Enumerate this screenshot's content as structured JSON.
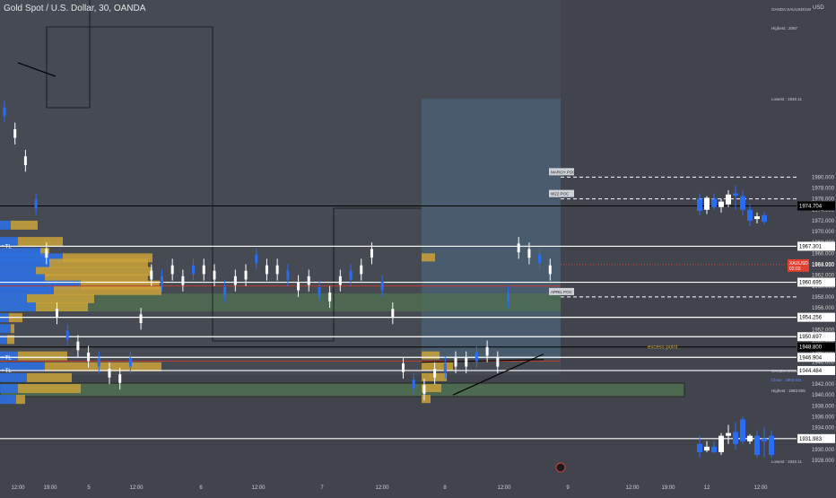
{
  "colors": {
    "background": "#41444c",
    "up": "#ffffff",
    "down": "#2a6df5",
    "profile_gold": "#caa23a",
    "profile_blue": "#2d6fe0",
    "zone_green": "#4f6e50",
    "zone_blue": "#4d6b85",
    "axis_text": "#d0d0d0",
    "price_tag": "#e0402f"
  },
  "chart_data": {
    "type": "candlestick",
    "title": "Gold Spot / U.S. Dollar, 30, OANDA",
    "ylim": [
      1926.5,
      2002.5
    ],
    "price_ticks": [
      1928.0,
      1930.0,
      1932.0,
      1934.0,
      1936.0,
      1938.0,
      1940.0,
      1942.0,
      1944.0,
      1946.0,
      1948.0,
      1950.0,
      1952.0,
      1954.0,
      1956.0,
      1958.0,
      1960.0,
      1962.0,
      1964.0,
      1966.0,
      1968.0,
      1970.0,
      1972.0,
      1974.0,
      1976.0,
      1978.0,
      1980.0
    ],
    "axis_unit": "USD",
    "time_labels": [
      "12:00",
      "19:00",
      "5",
      "12:00",
      "6",
      "12:00",
      "7",
      "12:00",
      "8",
      "12:00",
      "9",
      "12:00",
      "19:00",
      "12",
      "12:00"
    ],
    "horizontal_levels": [
      {
        "price": 1974.704,
        "label": "1974.704",
        "style": "solid-dark"
      },
      {
        "price": 1967.301,
        "label": "1967.301",
        "style": "solid"
      },
      {
        "price": 1960.695,
        "label": "1960.695",
        "style": "solid"
      },
      {
        "price": 1954.256,
        "label": "1954.256",
        "style": "solid"
      },
      {
        "price": 1950.697,
        "label": "1950.697",
        "style": "solid"
      },
      {
        "price": 1948.8,
        "label": "1948.800",
        "style": "solid-dark"
      },
      {
        "price": 1946.904,
        "label": "1946.904",
        "style": "solid"
      },
      {
        "price": 1944.484,
        "label": "1944.484",
        "style": "solid"
      },
      {
        "price": 1931.983,
        "label": "1931.983",
        "style": "solid"
      }
    ],
    "poc_levels": [
      {
        "label": "MARCH POC",
        "price": 1980.0
      },
      {
        "label": "W22 POC",
        "price": 1976.0
      },
      {
        "label": "APRIL POC",
        "price": 1958.0
      }
    ],
    "current_price": {
      "symbol": "XAUUSD",
      "value": "1963.930",
      "countdown": "02:03"
    },
    "annotations": {
      "excess_point": "excess point",
      "tl_label": "TL"
    },
    "inset_weekly": {
      "symbol": "OANDA:XAUUSD/1W",
      "highest": "Highest : 2067",
      "lowest": "Lowest : 1932.11"
    },
    "inset_daily": {
      "symbol": "OANDA:XAUUSD/1D",
      "close": "Close : 1963.931",
      "highest": "Highest : 1983.505",
      "lowest": "Lowest : 1932.11"
    },
    "weekly_candles": [
      {
        "o": 1976.0,
        "h": 1977.0,
        "l": 1973.0,
        "c": 1973.8
      },
      {
        "o": 1974.0,
        "h": 1976.5,
        "l": 1973.2,
        "c": 1976.2
      },
      {
        "o": 1976.0,
        "h": 1977.0,
        "l": 1974.0,
        "c": 1974.5
      },
      {
        "o": 1974.5,
        "h": 1976.0,
        "l": 1973.5,
        "c": 1975.5
      },
      {
        "o": 1975.0,
        "h": 1977.6,
        "l": 1974.5,
        "c": 1976.8
      },
      {
        "o": 1977.0,
        "h": 1978.5,
        "l": 1974.0,
        "c": 1976.6
      },
      {
        "o": 1976.5,
        "h": 1977.5,
        "l": 1973.0,
        "c": 1974.0
      },
      {
        "o": 1974.0,
        "h": 1975.0,
        "l": 1971.0,
        "c": 1972.0
      },
      {
        "o": 1972.3,
        "h": 1973.5,
        "l": 1971.5,
        "c": 1972.8
      },
      {
        "o": 1973.0,
        "h": 1973.6,
        "l": 1971.3,
        "c": 1971.8
      }
    ],
    "daily_candles": [
      {
        "o": 1931.0,
        "h": 1932.5,
        "l": 1928.5,
        "c": 1929.5
      },
      {
        "o": 1929.8,
        "h": 1931.5,
        "l": 1929.5,
        "c": 1930.5
      },
      {
        "o": 1930.5,
        "h": 1931.5,
        "l": 1929.3,
        "c": 1929.5
      },
      {
        "o": 1929.5,
        "h": 1933.0,
        "l": 1929.0,
        "c": 1932.5
      },
      {
        "o": 1932.5,
        "h": 1934.5,
        "l": 1931.0,
        "c": 1933.0
      },
      {
        "o": 1933.2,
        "h": 1935.0,
        "l": 1930.0,
        "c": 1931.0
      },
      {
        "o": 1935.5,
        "h": 1936.0,
        "l": 1931.0,
        "c": 1931.5
      },
      {
        "o": 1931.5,
        "h": 1932.8,
        "l": 1931.0,
        "c": 1932.5
      },
      {
        "o": 1932.5,
        "h": 1933.5,
        "l": 1928.5,
        "c": 1929.0
      },
      {
        "o": 1932.0,
        "h": 1934.0,
        "l": 1928.5,
        "c": 1931.5
      },
      {
        "o": 1932.5,
        "h": 1933.5,
        "l": 1928.5,
        "c": 1929.0
      }
    ]
  }
}
